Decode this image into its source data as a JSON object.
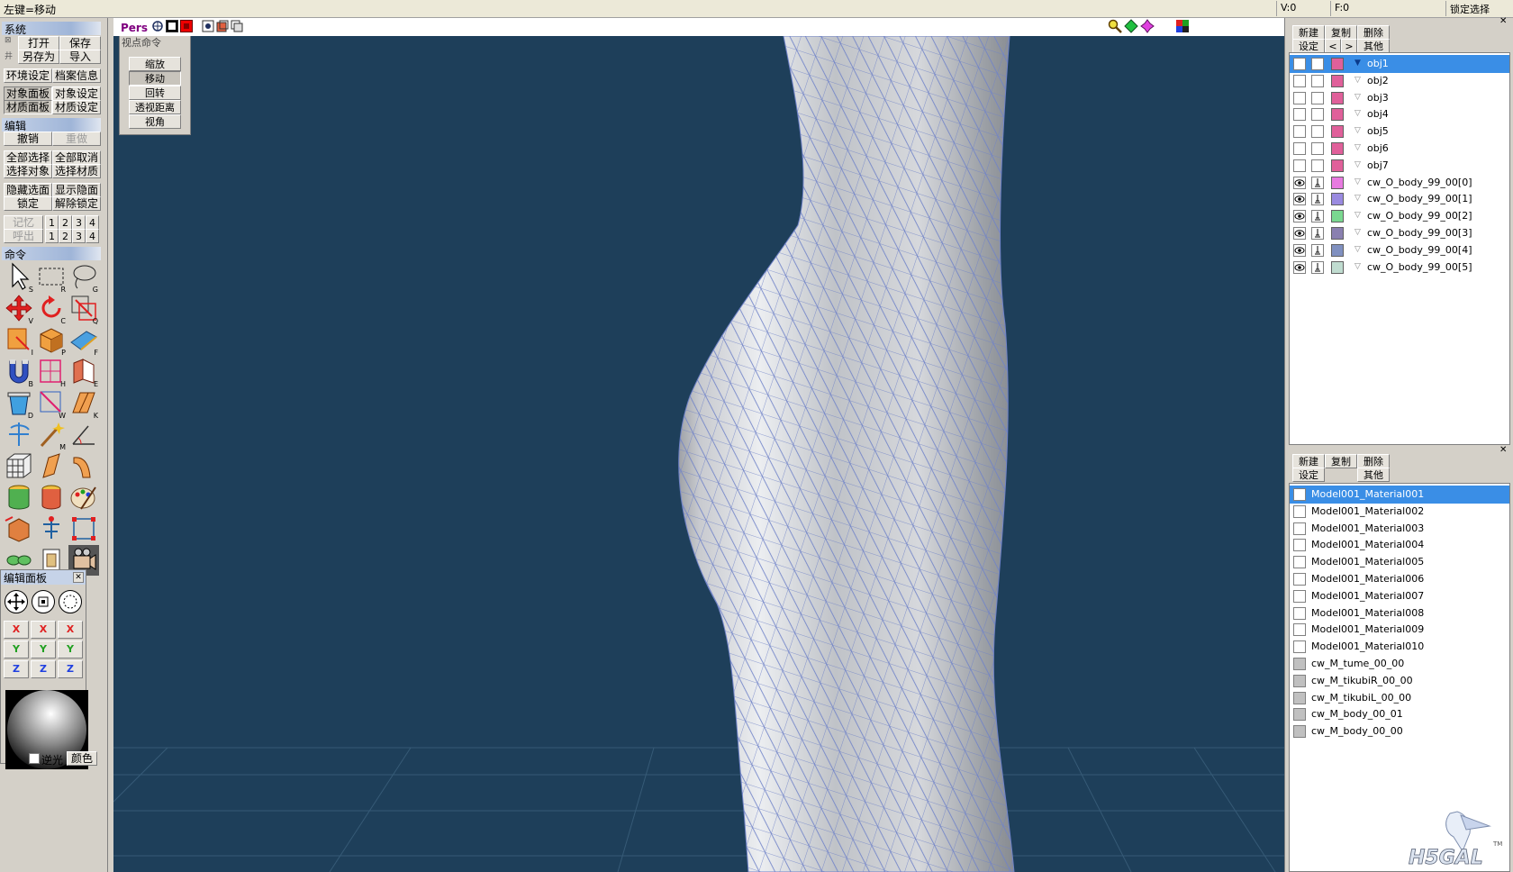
{
  "status": {
    "hint": "左键=移动",
    "v": "V:0",
    "f": "F:0",
    "lock": "锁定选择"
  },
  "left": {
    "system": {
      "title": "系统",
      "open": "打开",
      "save": "保存",
      "saveas": "另存为",
      "import": "导入",
      "env": "环境设定",
      "fileinfo": "档案信息",
      "objpanel": "对象面板",
      "objset": "对象设定",
      "matpanel": "材质面板",
      "matset": "材质设定"
    },
    "edit": {
      "title": "编辑",
      "undo": "撤销",
      "redo": "重做",
      "selall": "全部选择",
      "deselall": "全部取消",
      "selobj": "选择对象",
      "selmat": "选择材质",
      "hidesel": "隐藏选面",
      "showhid": "显示隐面",
      "lock": "锁定",
      "unlock": "解除锁定",
      "memory": "记忆",
      "recall": "呼出",
      "nums": [
        "1",
        "2",
        "3",
        "4"
      ]
    },
    "command": {
      "title": "命令",
      "keys": [
        "S",
        "R",
        "G",
        "V",
        "C",
        "Q",
        "I",
        "P",
        "F",
        "B",
        "H",
        "E",
        "D",
        "W",
        "K",
        "",
        "M",
        "",
        "",
        "",
        "",
        "",
        "",
        "",
        "",
        "",
        ""
      ]
    },
    "editpanel": {
      "title": "编辑面板",
      "x": "X",
      "y": "Y",
      "z": "Z",
      "backlight": "逆光",
      "color": "颜色"
    }
  },
  "viewport": {
    "mode": "Pers",
    "cmd": {
      "title": "视点命令",
      "zoom": "缩放",
      "move": "移动",
      "rotate": "回转",
      "persp": "透视距离",
      "fov": "视角"
    }
  },
  "objects": {
    "new": "新建",
    "copy": "复制",
    "del": "删除",
    "set": "设定",
    "prev": "<",
    "next": ">",
    "other": "其他",
    "items": [
      {
        "name": "obj1",
        "color": "#e0609a"
      },
      {
        "name": "obj2",
        "color": "#e0609a"
      },
      {
        "name": "obj3",
        "color": "#e0609a"
      },
      {
        "name": "obj4",
        "color": "#e0609a"
      },
      {
        "name": "obj5",
        "color": "#e0609a"
      },
      {
        "name": "obj6",
        "color": "#e0609a"
      },
      {
        "name": "obj7",
        "color": "#e0609a"
      },
      {
        "name": "cw_O_body_99_00[0]",
        "color": "#e87ae0"
      },
      {
        "name": "cw_O_body_99_00[1]",
        "color": "#9a8ae0"
      },
      {
        "name": "cw_O_body_99_00[2]",
        "color": "#7ad890"
      },
      {
        "name": "cw_O_body_99_00[3]",
        "color": "#8a80b0"
      },
      {
        "name": "cw_O_body_99_00[4]",
        "color": "#8090c0"
      },
      {
        "name": "cw_O_body_99_00[5]",
        "color": "#c0dcd0"
      }
    ]
  },
  "materials": {
    "new": "新建",
    "copy": "复制",
    "del": "删除",
    "set": "设定",
    "other": "其他",
    "items": [
      "Model001_Material001",
      "Model001_Material002",
      "Model001_Material003",
      "Model001_Material004",
      "Model001_Material005",
      "Model001_Material006",
      "Model001_Material007",
      "Model001_Material008",
      "Model001_Material009",
      "Model001_Material010",
      "cw_M_tume_00_00",
      "cw_M_tikubiR_00_00",
      "cw_M_tikubiL_00_00",
      "cw_M_body_00_01",
      "cw_M_body_00_00"
    ]
  },
  "logo": {
    "text": "H5GAL",
    "tm": "TM"
  }
}
